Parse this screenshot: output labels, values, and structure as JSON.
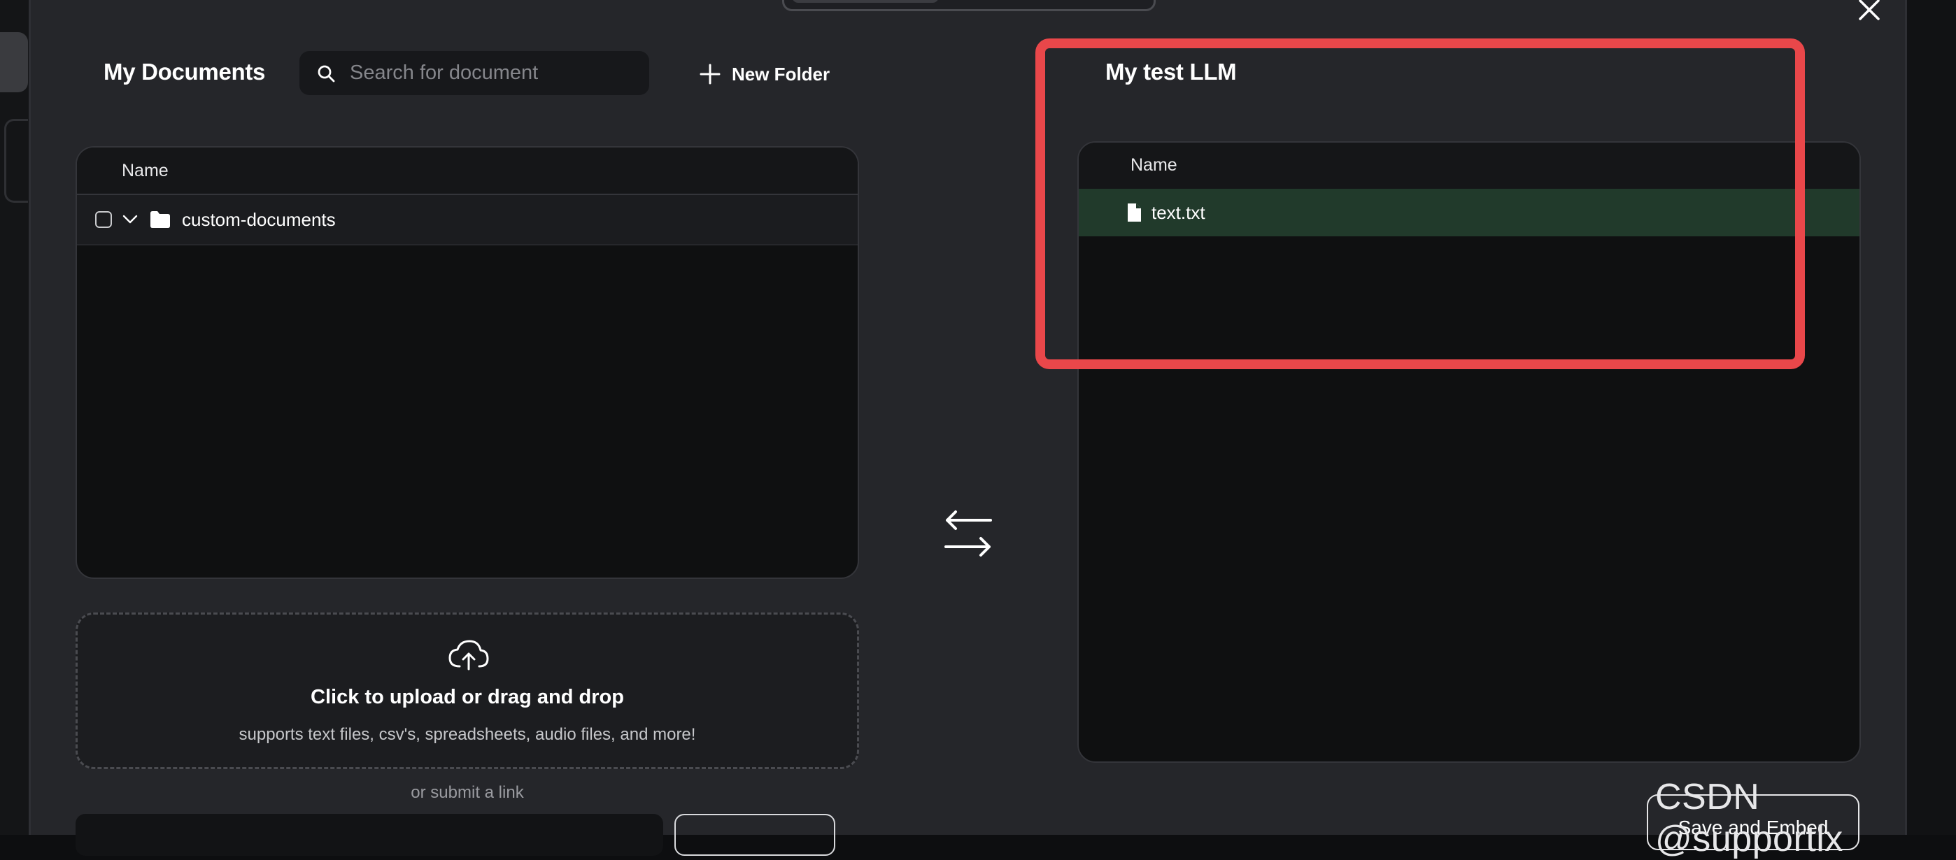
{
  "colors": {
    "modal_bg": "#25262a",
    "panel_bg": "#0f1011",
    "selected_row": "#213a2b",
    "highlight_border": "#e9474a"
  },
  "left": {
    "title": "My Documents",
    "search": {
      "placeholder": "Search for document",
      "value": "",
      "icon": "search-icon"
    },
    "new_folder_label": "New Folder",
    "table": {
      "column_name": "Name",
      "rows": [
        {
          "label": "custom-documents",
          "type": "folder",
          "checked": false,
          "expanded": true
        }
      ]
    },
    "upload": {
      "icon": "cloud-upload-icon",
      "title": "Click to upload or drag and drop",
      "subtitle": "supports text files, csv's, spreadsheets, audio files, and more!"
    },
    "submit_link_label": "or submit a link"
  },
  "right": {
    "title": "My test LLM",
    "table": {
      "column_name": "Name",
      "rows": [
        {
          "label": "text.txt",
          "type": "file",
          "selected": true
        }
      ]
    },
    "save_button_label": "Save and Embed"
  },
  "watermark": "CSDN @supportlx"
}
